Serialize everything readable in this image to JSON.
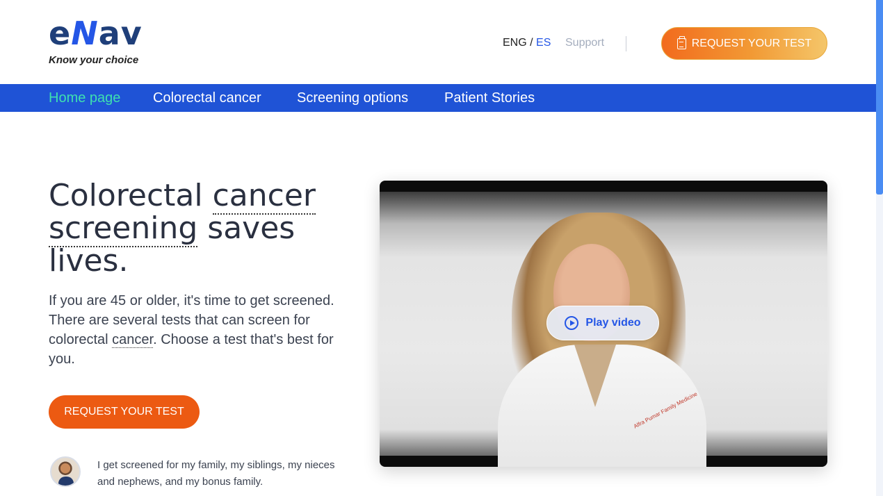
{
  "header": {
    "logo_text_pre": "e",
    "logo_text_n": "N",
    "logo_text_post": "av",
    "tagline": "Know your choice",
    "lang_eng": "ENG",
    "lang_sep": " / ",
    "lang_es": "ES",
    "support": "Support",
    "request_button": "REQUEST YOUR TEST"
  },
  "nav": {
    "items": [
      {
        "label": "Home page",
        "active": true
      },
      {
        "label": "Colorectal cancer",
        "active": false
      },
      {
        "label": "Screening options",
        "active": false
      },
      {
        "label": "Patient Stories",
        "active": false
      }
    ]
  },
  "hero": {
    "title_part1": "Colorectal ",
    "title_link1": "cancer",
    "title_link2": "screening",
    "title_part2": " saves lives.",
    "body_part1": "If you are 45 or older, it's time to get screened. There are several tests that can screen for colorectal ",
    "body_link": "cancer",
    "body_part2": ". Choose a test that's best for you.",
    "request_button": "REQUEST YOUR TEST",
    "quote": "I get screened for my family, my siblings, my nieces and nephews, and my bonus family."
  },
  "video": {
    "play_label": "Play video",
    "coat_text": "Alfra Pumar\nFamily Medicine"
  },
  "colors": {
    "nav_bg": "#1f53d6",
    "nav_active": "#3ee0b0",
    "accent_orange": "#ec5a12",
    "brand_blue": "#2456e6"
  }
}
